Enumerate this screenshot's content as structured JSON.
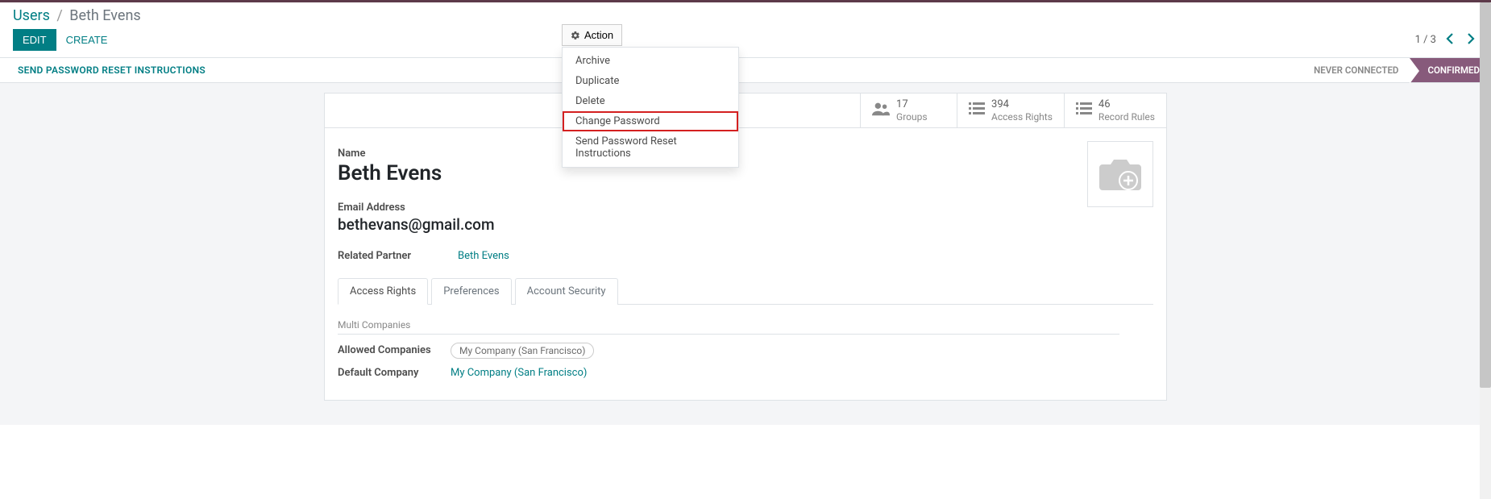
{
  "breadcrumb": {
    "root": "Users",
    "current": "Beth Evens"
  },
  "toolbar": {
    "edit": "EDIT",
    "create": "CREATE",
    "action": "Action",
    "pager": "1 / 3"
  },
  "action_menu": {
    "archive": "Archive",
    "duplicate": "Duplicate",
    "delete": "Delete",
    "change_password": "Change Password",
    "send_reset": "Send Password Reset Instructions"
  },
  "statusbar": {
    "send_reset_btn": "SEND PASSWORD RESET INSTRUCTIONS",
    "never_connected": "NEVER CONNECTED",
    "confirmed": "CONFIRMED"
  },
  "stats": {
    "groups_count": "17",
    "groups_label": "Groups",
    "access_count": "394",
    "access_label": "Access Rights",
    "rules_count": "46",
    "rules_label": "Record Rules"
  },
  "form": {
    "name_label": "Name",
    "name_value": "Beth Evens",
    "email_label": "Email Address",
    "email_value": "bethevans@gmail.com",
    "partner_label": "Related Partner",
    "partner_value": "Beth Evens"
  },
  "tabs": {
    "access_rights": "Access Rights",
    "preferences": "Preferences",
    "account_security": "Account Security"
  },
  "multi": {
    "section": "Multi Companies",
    "allowed_label": "Allowed Companies",
    "allowed_tag": "My Company (San Francisco)",
    "default_label": "Default Company",
    "default_value": "My Company (San Francisco)"
  }
}
